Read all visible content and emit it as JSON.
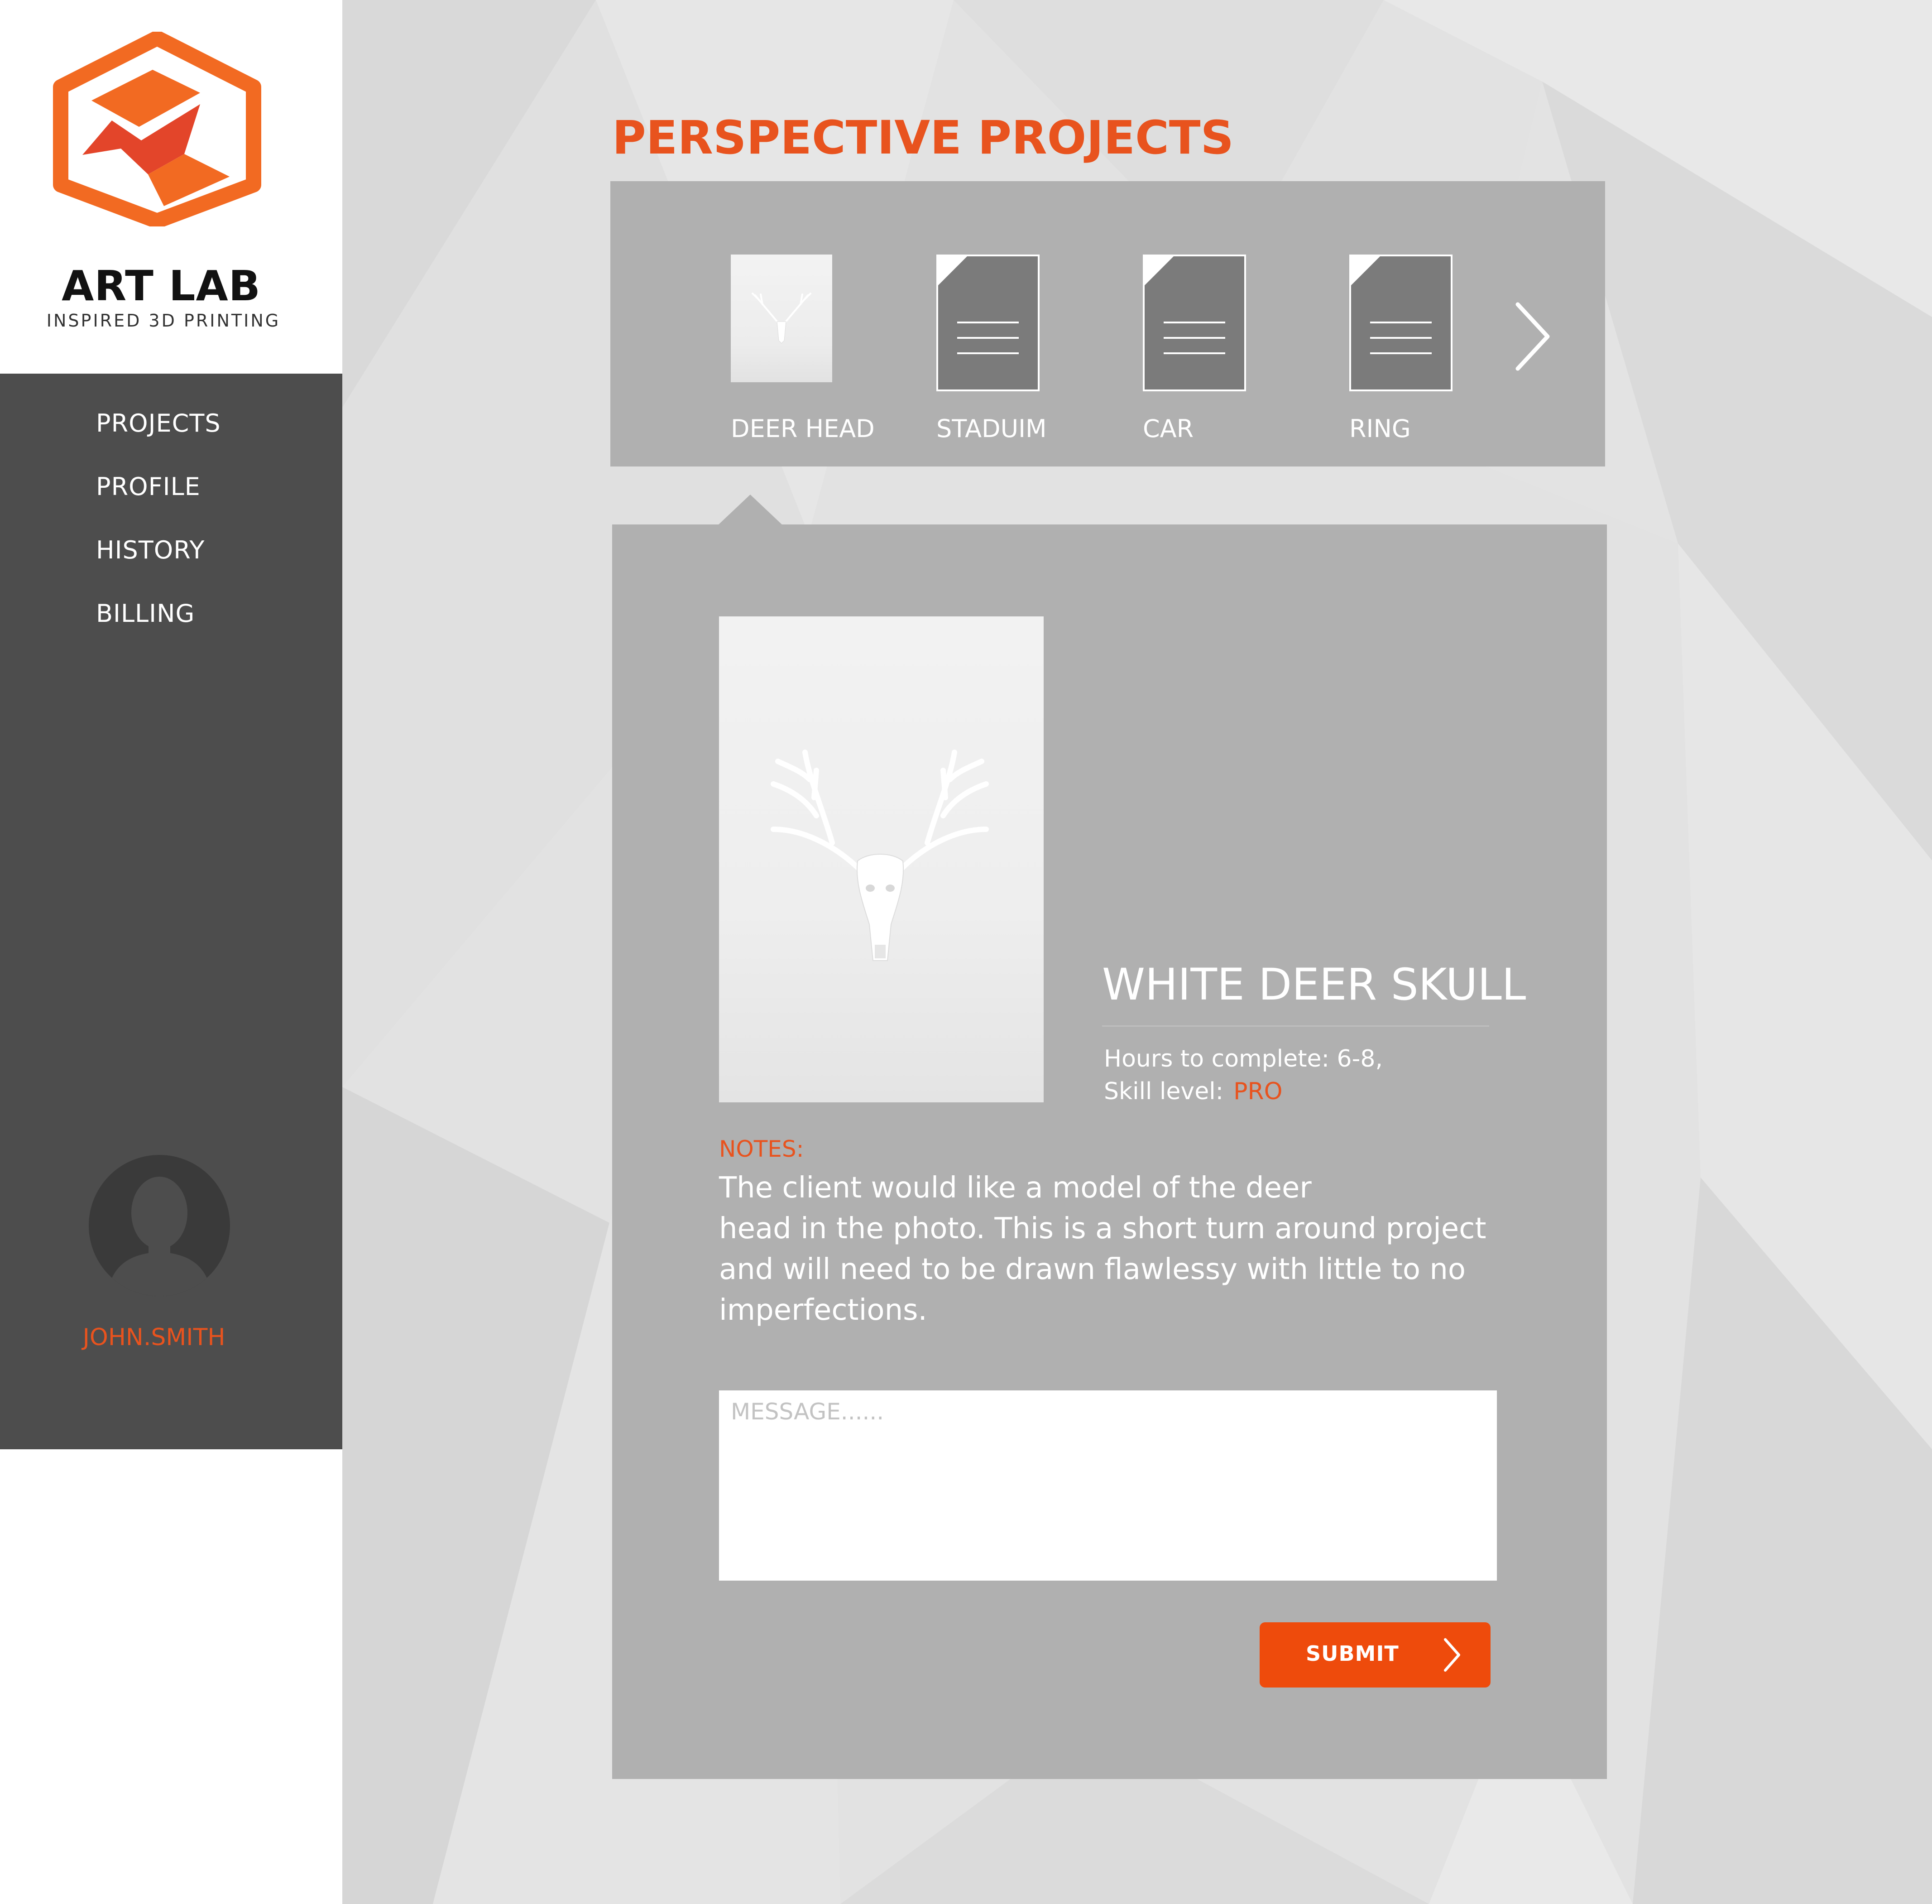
{
  "brand": {
    "name": "ART LAB",
    "tagline": "INSPIRED 3D PRINTING",
    "logo_icon": "art-lab-hexagon-logo",
    "accent_color": "#e8531e"
  },
  "sidebar": {
    "items": [
      {
        "label": "PROJECTS"
      },
      {
        "label": "PROFILE"
      },
      {
        "label": "HISTORY"
      },
      {
        "label": "BILLING"
      }
    ],
    "user": {
      "avatar_icon": "user-avatar-icon",
      "name": "JOHN.SMITH"
    }
  },
  "main": {
    "title": "PERSPECTIVE PROJECTS",
    "carousel": {
      "items": [
        {
          "label": "DEER HEAD",
          "thumbnail": "deer-head-photo"
        },
        {
          "label": "STADUIM",
          "thumbnail": "document-icon"
        },
        {
          "label": "CAR",
          "thumbnail": "document-icon"
        },
        {
          "label": "RING",
          "thumbnail": "document-icon"
        }
      ],
      "next_icon": "chevron-right-icon"
    },
    "detail": {
      "name": "WHITE DEER SKULL",
      "hours": "Hours to complete: 6-8,",
      "skill_label": "Skill level:",
      "skill_value": "PRO",
      "notes_label": "NOTES:",
      "notes_lines": [
        "The client would like a model of the deer",
        "head in the photo. This is a short turn around project",
        "and will need to be drawn flawlessy with little to no",
        "imperfections."
      ],
      "message": {
        "value": "",
        "placeholder": "MESSAGE......"
      },
      "submit_label": "SUBMIT"
    }
  },
  "colors": {
    "sidebar_bg": "#4d4d4d",
    "panel_bg": "#b0b0b0",
    "submit_bg": "#ee4b0c"
  }
}
